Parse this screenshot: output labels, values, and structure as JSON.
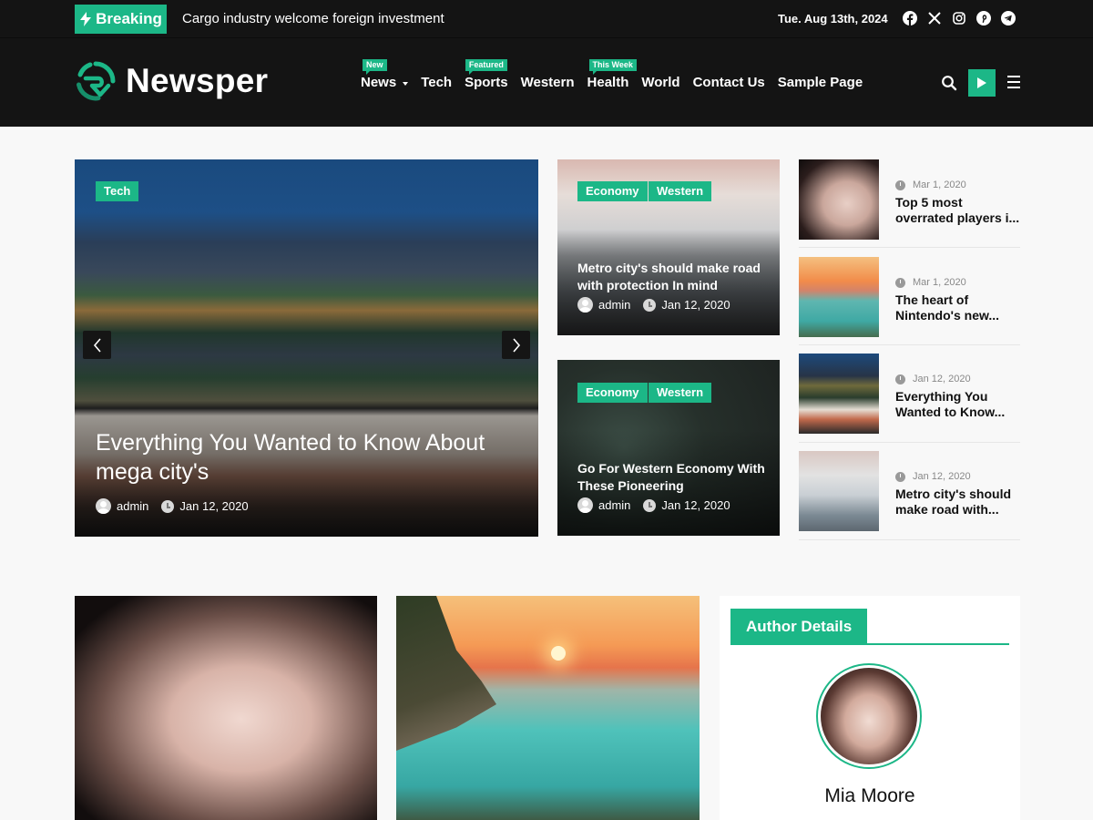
{
  "topbar": {
    "breaking_label": "Breaking",
    "ticker_text": "Cargo industry welcome foreign investment",
    "date": "Tue. Aug 13th, 2024",
    "socials": [
      "facebook-icon",
      "x-icon",
      "instagram-icon",
      "pinterest-icon",
      "telegram-icon"
    ]
  },
  "header": {
    "logo_text": "Newsper",
    "nav": [
      {
        "label": "News",
        "badge": "New",
        "has_dropdown": true
      },
      {
        "label": "Tech",
        "badge": null
      },
      {
        "label": "Sports",
        "badge": "Featured"
      },
      {
        "label": "Western",
        "badge": null
      },
      {
        "label": "Health",
        "badge": "This Week"
      },
      {
        "label": "World",
        "badge": null
      },
      {
        "label": "Contact Us",
        "badge": null
      },
      {
        "label": "Sample Page",
        "badge": null
      }
    ],
    "accent_color": "#1cb787"
  },
  "hero": {
    "main": {
      "tag": "Tech",
      "title": "Everything You Wanted to Know About mega city's",
      "author": "admin",
      "date": "Jan 12, 2020"
    },
    "cards": [
      {
        "tags": [
          "Economy",
          "Western"
        ],
        "title": "Metro city's should make road with protection In mind",
        "author": "admin",
        "date": "Jan 12, 2020"
      },
      {
        "tags": [
          "Economy",
          "Western"
        ],
        "title": "Go For Western Economy With These Pioneering",
        "author": "admin",
        "date": "Jan 12, 2020"
      }
    ],
    "side_list": [
      {
        "date": "Mar 1, 2020",
        "title": "Top 5 most overrated players i..."
      },
      {
        "date": "Mar 1, 2020",
        "title": "The heart of Nintendo's new..."
      },
      {
        "date": "Jan 12, 2020",
        "title": "Everything You Wanted to Know..."
      },
      {
        "date": "Jan 12, 2020",
        "title": "Metro city's should make road with..."
      }
    ]
  },
  "widget": {
    "title": "Author Details",
    "author_name": "Mia Moore"
  }
}
